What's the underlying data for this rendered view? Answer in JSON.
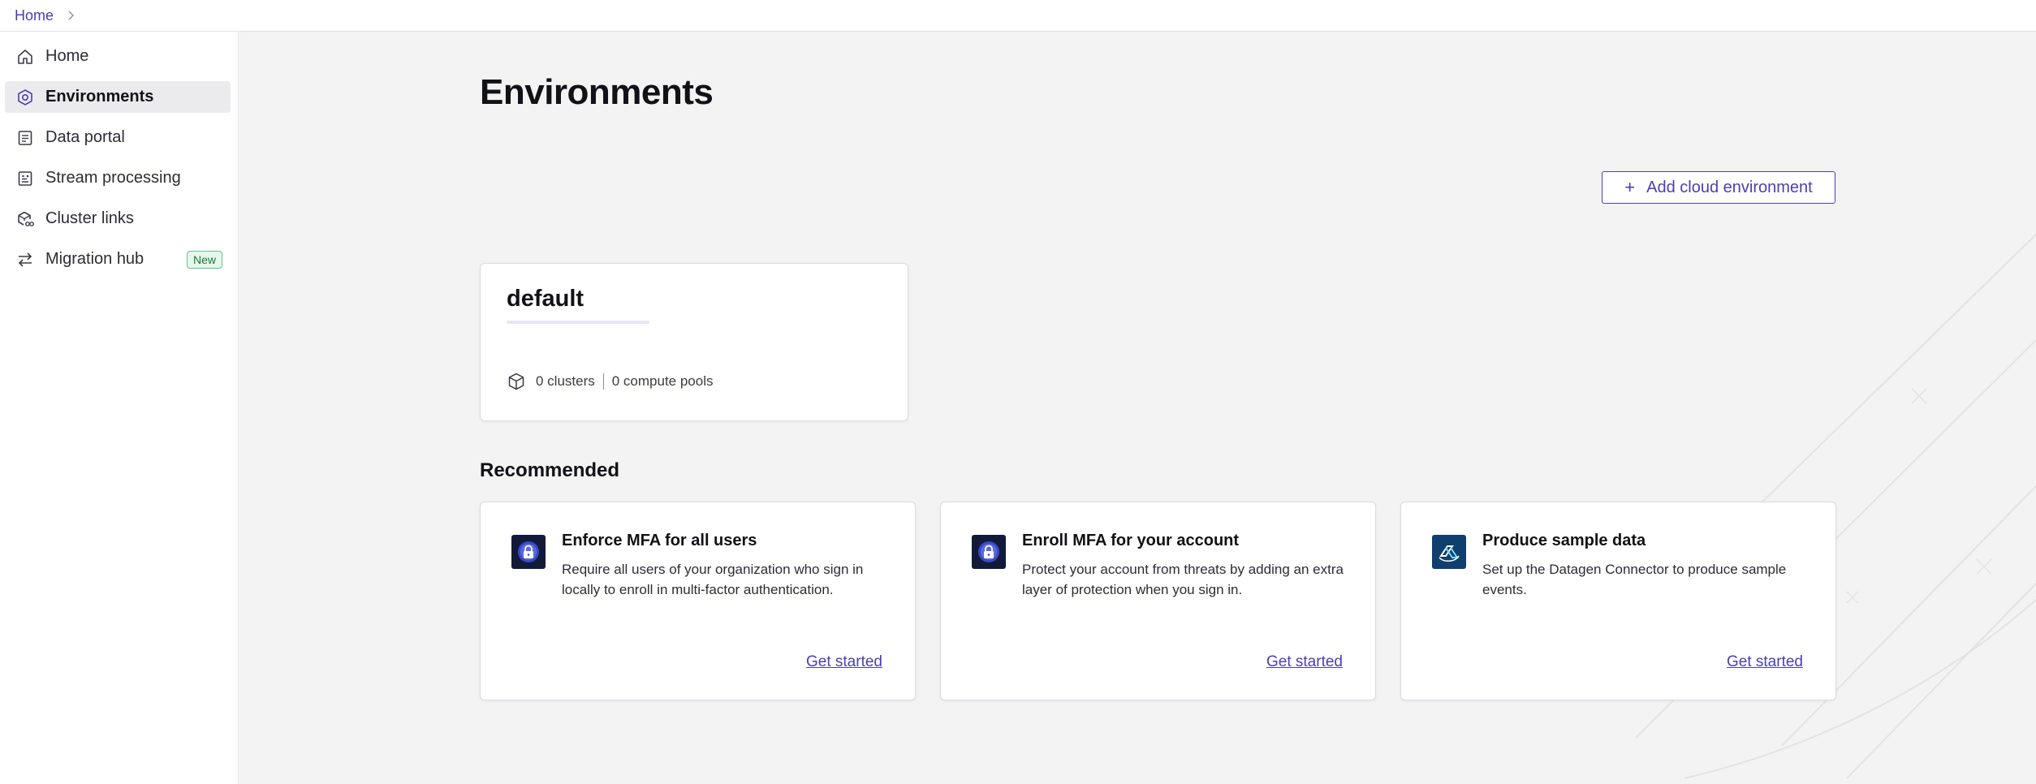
{
  "breadcrumb": {
    "home": "Home"
  },
  "sidebar": {
    "items": [
      {
        "label": "Home",
        "icon": "home-icon"
      },
      {
        "label": "Environments",
        "icon": "environment-icon",
        "active": true
      },
      {
        "label": "Data portal",
        "icon": "data-portal-icon"
      },
      {
        "label": "Stream processing",
        "icon": "stream-processing-icon"
      },
      {
        "label": "Cluster links",
        "icon": "cluster-links-icon"
      },
      {
        "label": "Migration hub",
        "icon": "migration-hub-icon",
        "badge": "New"
      }
    ]
  },
  "main": {
    "title": "Environments",
    "add_button": "Add cloud environment",
    "environment": {
      "name": "default",
      "clusters": "0 clusters",
      "compute_pools": "0 compute pools"
    },
    "recommended_title": "Recommended",
    "recommended": [
      {
        "title": "Enforce MFA for all users",
        "description": "Require all users of your organization who sign in locally to enroll in multi-factor authentication.",
        "link": "Get started",
        "icon": "mfa-lock-icon"
      },
      {
        "title": "Enroll MFA for your account",
        "description": "Protect your account from threats by adding an extra layer of protection when you sign in.",
        "link": "Get started",
        "icon": "mfa-lock-icon"
      },
      {
        "title": "Produce sample data",
        "description": "Set up the Datagen Connector to produce sample events.",
        "link": "Get started",
        "icon": "datagen-connector-icon"
      }
    ]
  },
  "colors": {
    "accent": "#4a3fb4",
    "background": "#f3f3f4",
    "sidebar_active": "#ebebee",
    "badge_green": "#1a7a3e"
  }
}
